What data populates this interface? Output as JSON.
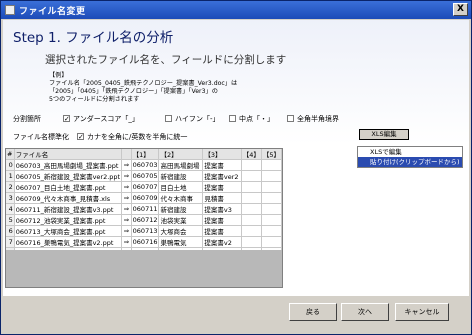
{
  "window": {
    "title": "ファイル名変更",
    "close_label": "X"
  },
  "step_title": "Step 1. ファイル名の分析",
  "subtitle": "選択されたファイル名を、フィールドに分割します",
  "example": {
    "heading": "【例】",
    "lines": [
      "ファイル名「2005_0405_鉄飛テクノロジー_提案書_Ver3.doc」は",
      "「2005」「0405」「鉄飛テクノロジー」「提案書」「Ver3」の",
      "5つのフィールドに分割されます"
    ]
  },
  "split": {
    "label": "分割箇所",
    "options": [
      {
        "label": "アンダースコア「_」",
        "checked": true
      },
      {
        "label": "ハイフン「-」",
        "checked": false
      },
      {
        "label": "中点「・」",
        "checked": false
      },
      {
        "label": "全角半角境界",
        "checked": false
      }
    ]
  },
  "normalize": {
    "label": "ファイル名標準化",
    "option": {
      "label": "カナを全角に/英数を半角に統一",
      "checked": true
    }
  },
  "xls_button": "XLS編集",
  "menu": [
    {
      "label": "XLSで編集",
      "selected": false
    },
    {
      "label": "貼り付け(クリップボードから)",
      "selected": true
    }
  ],
  "table": {
    "headers": [
      "#",
      "ファイル名",
      "",
      "【1】",
      "【2】",
      "【3】",
      "【4】",
      "【5】"
    ],
    "rows": [
      [
        "0",
        "060703_高田馬場劇場_提案書.ppt",
        "⇒",
        "060703",
        "高田馬場劇場",
        "提案書",
        "",
        ""
      ],
      [
        "1",
        "060705_新宿建設_提案書ver2.ppt",
        "⇒",
        "060705",
        "新宿建設",
        "提案書ver2",
        "",
        ""
      ],
      [
        "2",
        "060707_目白土地_提案書.ppt",
        "⇒",
        "060707",
        "目白土地",
        "提案書",
        "",
        ""
      ],
      [
        "3",
        "060709_代々木商事_見積書.xls",
        "⇒",
        "060709",
        "代々木商事",
        "見積書",
        "",
        ""
      ],
      [
        "4",
        "060711_新宿建設_提案書v3.ppt",
        "⇒",
        "060711",
        "新宿建設",
        "提案書v3",
        "",
        ""
      ],
      [
        "5",
        "060712_池袋実業_提案書.ppt",
        "⇒",
        "060712",
        "池袋実業",
        "提案書",
        "",
        ""
      ],
      [
        "6",
        "060713_大塚商会_提案書.ppt",
        "⇒",
        "060713",
        "大塚商会",
        "提案書",
        "",
        ""
      ],
      [
        "7",
        "060716_巣鴨電気_提案書v2.ppt",
        "⇒",
        "060716",
        "巣鴨電気",
        "提案書v2",
        "",
        ""
      ],
      [
        "8",
        "060717_大塚商会_提案書v2.ppt",
        "⇒",
        "060717",
        "大塚商会",
        "提案書v2",
        "",
        ""
      ]
    ]
  },
  "buttons": {
    "back": "戻る",
    "next": "次へ",
    "cancel": "キャンセル"
  }
}
